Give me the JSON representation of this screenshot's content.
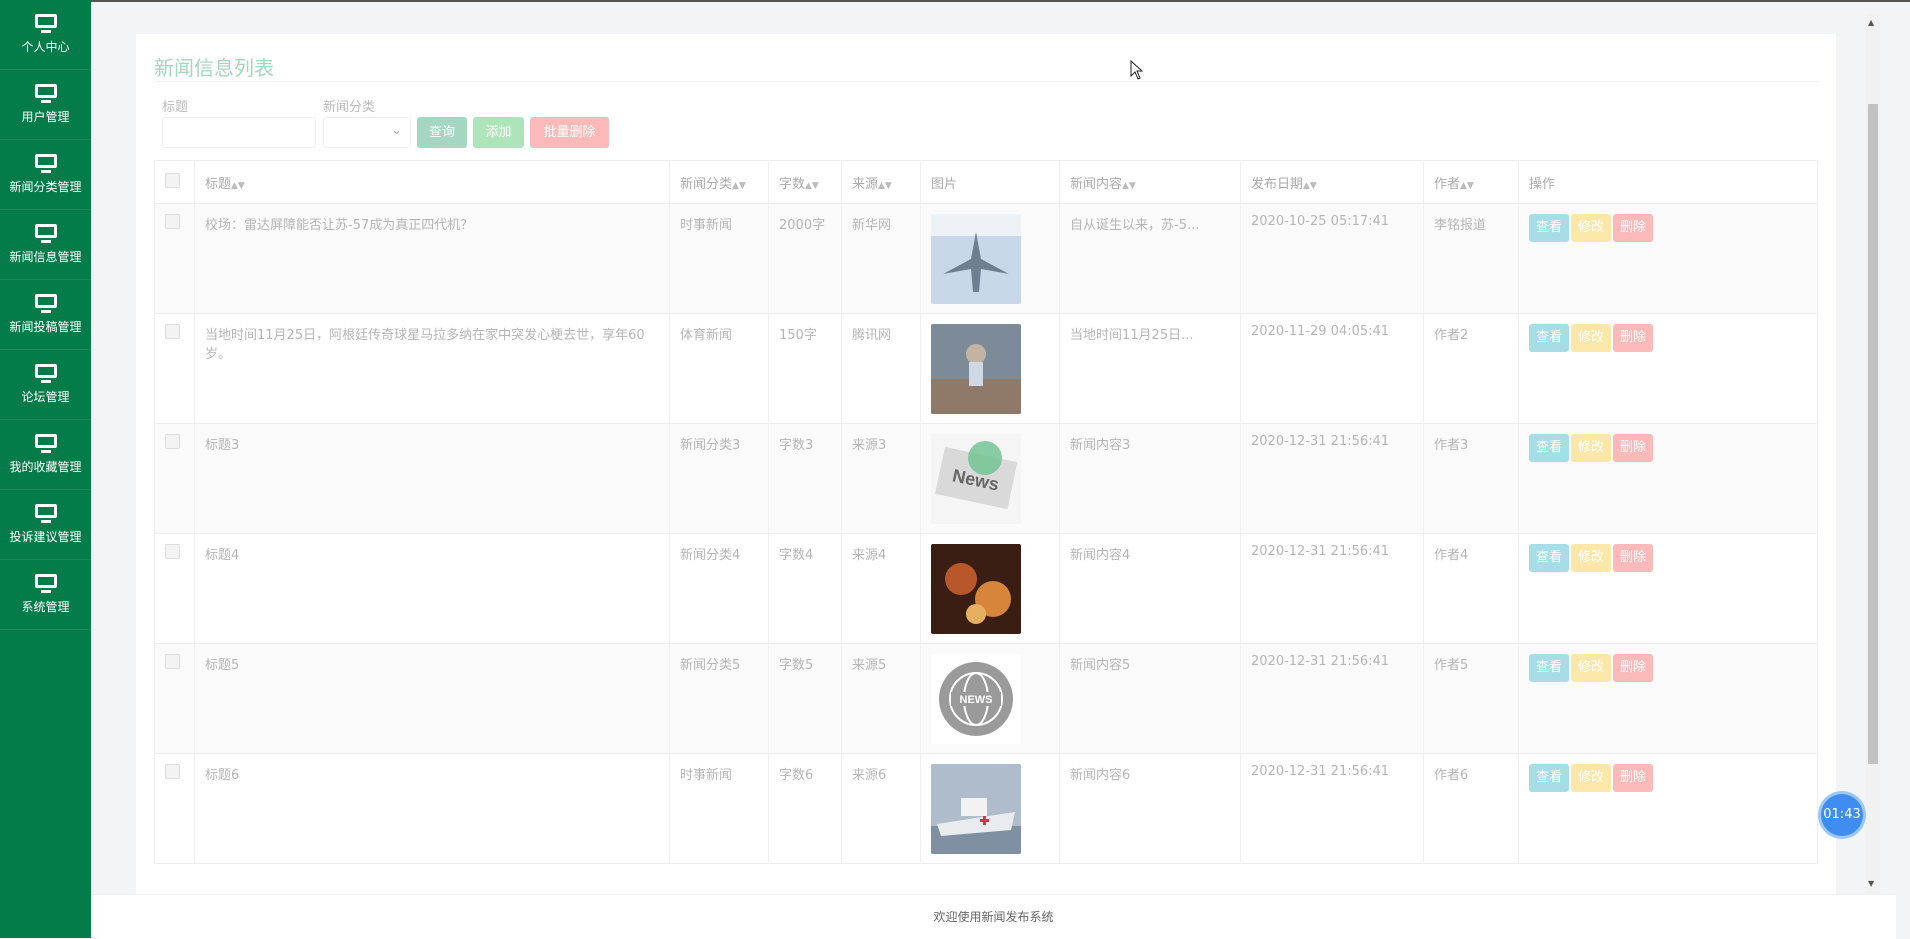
{
  "sidebar": {
    "items": [
      {
        "label": "个人中心"
      },
      {
        "label": "用户管理"
      },
      {
        "label": "新闻分类管理"
      },
      {
        "label": "新闻信息管理"
      },
      {
        "label": "新闻投稿管理"
      },
      {
        "label": "论坛管理"
      },
      {
        "label": "我的收藏管理"
      },
      {
        "label": "投诉建议管理"
      },
      {
        "label": "系统管理"
      }
    ]
  },
  "page": {
    "title": "新闻信息列表",
    "filters": {
      "title_label": "标题",
      "title_value": "",
      "category_label": "新闻分类",
      "category_value": ""
    },
    "buttons": {
      "query": "查询",
      "add": "添加",
      "bulk_delete": "批量删除"
    }
  },
  "table": {
    "headers": [
      "标题",
      "新闻分类",
      "字数",
      "来源",
      "图片",
      "新闻内容",
      "发布日期",
      "作者",
      "操作"
    ],
    "row_actions": {
      "view": "查看",
      "edit": "修改",
      "delete": "删除"
    },
    "rows": [
      {
        "title": "校场：雷达屏障能否让苏-57成为真正四代机？",
        "category": "时事新闻",
        "words": "2000字",
        "source": "新华网",
        "image": "fighter-jet-photo",
        "content": "自从诞生以来，苏-5...",
        "date": "2020-10-25 05:17:41",
        "author": "李铭报道"
      },
      {
        "title": "当地时间11月25日，阿根廷传奇球星马拉多纳在家中突发心梗去世，享年60岁。",
        "category": "体育新闻",
        "words": "150字",
        "source": "腾讯网",
        "image": "football-crowd-photo",
        "content": "当地时间11月25日...",
        "date": "2020-11-29 04:05:41",
        "author": "作者2"
      },
      {
        "title": "标题3",
        "category": "新闻分类3",
        "words": "字数3",
        "source": "来源3",
        "image": "news-paper-photo",
        "content": "新闻内容3",
        "date": "2020-12-31 21:56:41",
        "author": "作者3"
      },
      {
        "title": "标题4",
        "category": "新闻分类4",
        "words": "字数4",
        "source": "来源4",
        "image": "money-art-photo",
        "content": "新闻内容4",
        "date": "2020-12-31 21:56:41",
        "author": "作者4"
      },
      {
        "title": "标题5",
        "category": "新闻分类5",
        "words": "字数5",
        "source": "来源5",
        "image": "news-globe-icon",
        "content": "新闻内容5",
        "date": "2020-12-31 21:56:41",
        "author": "作者5"
      },
      {
        "title": "标题6",
        "category": "时事新闻",
        "words": "字数6",
        "source": "来源6",
        "image": "hospital-ship-photo",
        "content": "新闻内容6",
        "date": "2020-12-31 21:56:41",
        "author": "作者6"
      }
    ]
  },
  "footer": {
    "text": "欢迎使用新闻发布系统"
  },
  "timer": {
    "text": "01:43"
  },
  "colors": {
    "sidebar": "#047c4a",
    "view": "#a6dde6",
    "edit": "#fbe8a8",
    "delete": "#fbb9b9"
  }
}
